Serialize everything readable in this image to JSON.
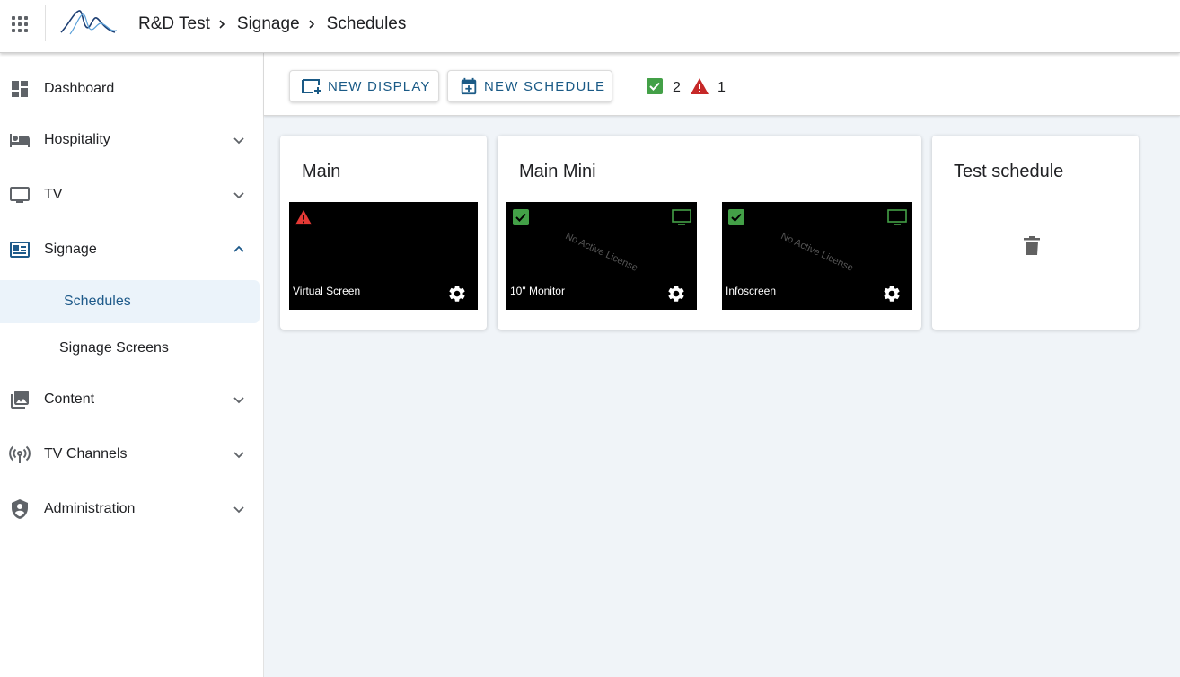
{
  "header": {
    "breadcrumb": [
      "R&D Test",
      "Signage",
      "Schedules"
    ]
  },
  "sidebar": {
    "items": [
      {
        "label": "Dashboard",
        "icon": "dashboard-icon"
      },
      {
        "label": "Hospitality",
        "icon": "bed-icon"
      },
      {
        "label": "TV",
        "icon": "tv-icon"
      },
      {
        "label": "Signage",
        "icon": "signage-icon"
      },
      {
        "label": "Content",
        "icon": "photo-library-icon"
      },
      {
        "label": "TV Channels",
        "icon": "antenna-icon"
      },
      {
        "label": "Administration",
        "icon": "shield-icon"
      }
    ],
    "signage_children": [
      "Schedules",
      "Signage Screens"
    ]
  },
  "toolbar": {
    "new_display": "NEW DISPLAY",
    "new_schedule": "NEW SCHEDULE",
    "ok_count": "2",
    "warn_count": "1"
  },
  "schedules": [
    {
      "title": "Main",
      "screens": [
        {
          "name": "Virtual Screen",
          "status": "warning"
        }
      ]
    },
    {
      "title": "Main Mini",
      "screens": [
        {
          "name": "10\" Monitor",
          "status": "ok",
          "watermark": "No Active License"
        },
        {
          "name": "Infoscreen",
          "status": "ok",
          "watermark": "No Active License"
        }
      ]
    },
    {
      "title": "Test schedule",
      "screens": []
    }
  ],
  "colors": {
    "accent": "#1a5a86",
    "active_bg": "#ebf3fa",
    "ok": "#43a047",
    "warn": "#e53935",
    "main_bg": "#f0f4f8"
  }
}
